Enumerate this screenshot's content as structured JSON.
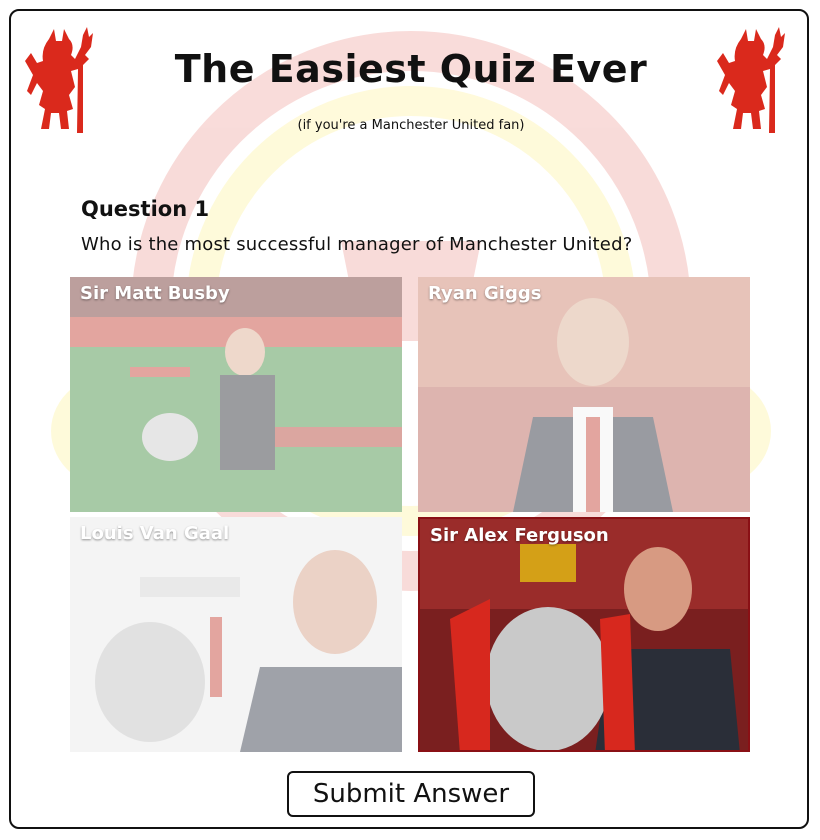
{
  "header": {
    "title": "The Easiest Quiz Ever",
    "subtitle": "(if you're a Manchester United fan)"
  },
  "question": {
    "number_label": "Question 1",
    "text": "Who is the most successful manager of Manchester United?",
    "options": [
      {
        "label": "Sir Matt Busby",
        "selected": false
      },
      {
        "label": "Ryan Giggs",
        "selected": false
      },
      {
        "label": "Louis Van Gaal",
        "selected": false
      },
      {
        "label": "Sir Alex Ferguson",
        "selected": true
      }
    ]
  },
  "submit": {
    "label": "Submit Answer"
  },
  "colors": {
    "brand_red": "#da291c",
    "selected_border": "#8a1015",
    "accent_yellow": "#fbe122"
  }
}
